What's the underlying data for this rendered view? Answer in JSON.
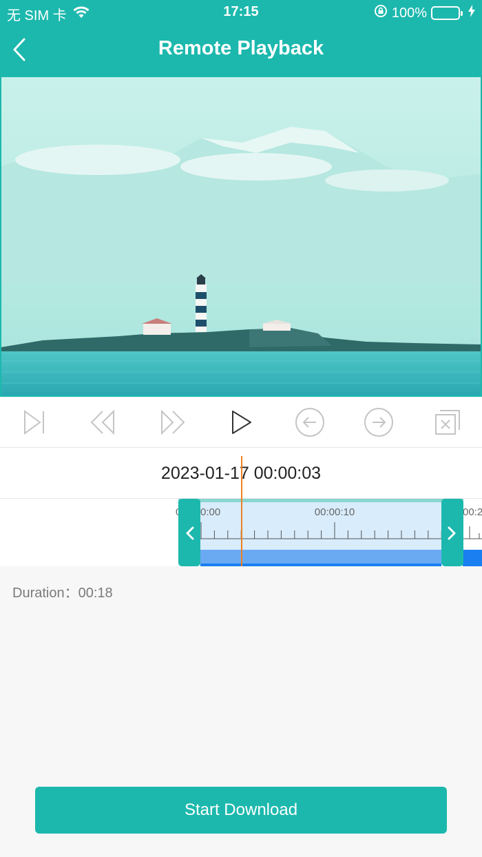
{
  "status": {
    "carrier": "无 SIM 卡",
    "time": "17:15",
    "battery_percent": "100%",
    "battery_level": 1.0
  },
  "nav": {
    "title": "Remote Playback"
  },
  "playback": {
    "current_time": "2023-01-17 00:00:03",
    "tick_labels": [
      "0:00",
      "00:00:10",
      "00:2"
    ]
  },
  "info": {
    "duration_label": "Duration：",
    "duration_value": "00:18"
  },
  "actions": {
    "download_label": "Start Download"
  },
  "colors": {
    "accent": "#1cb8ad",
    "playhead": "#f08020",
    "recording_bar": "#1a7ff0"
  },
  "icons": {
    "back": "chevron-left-icon",
    "controls": [
      "skip-to-end-icon",
      "rewind-icon",
      "fast-forward-icon",
      "play-icon",
      "previous-arrow-icon",
      "next-arrow-icon",
      "close-box-icon"
    ]
  }
}
